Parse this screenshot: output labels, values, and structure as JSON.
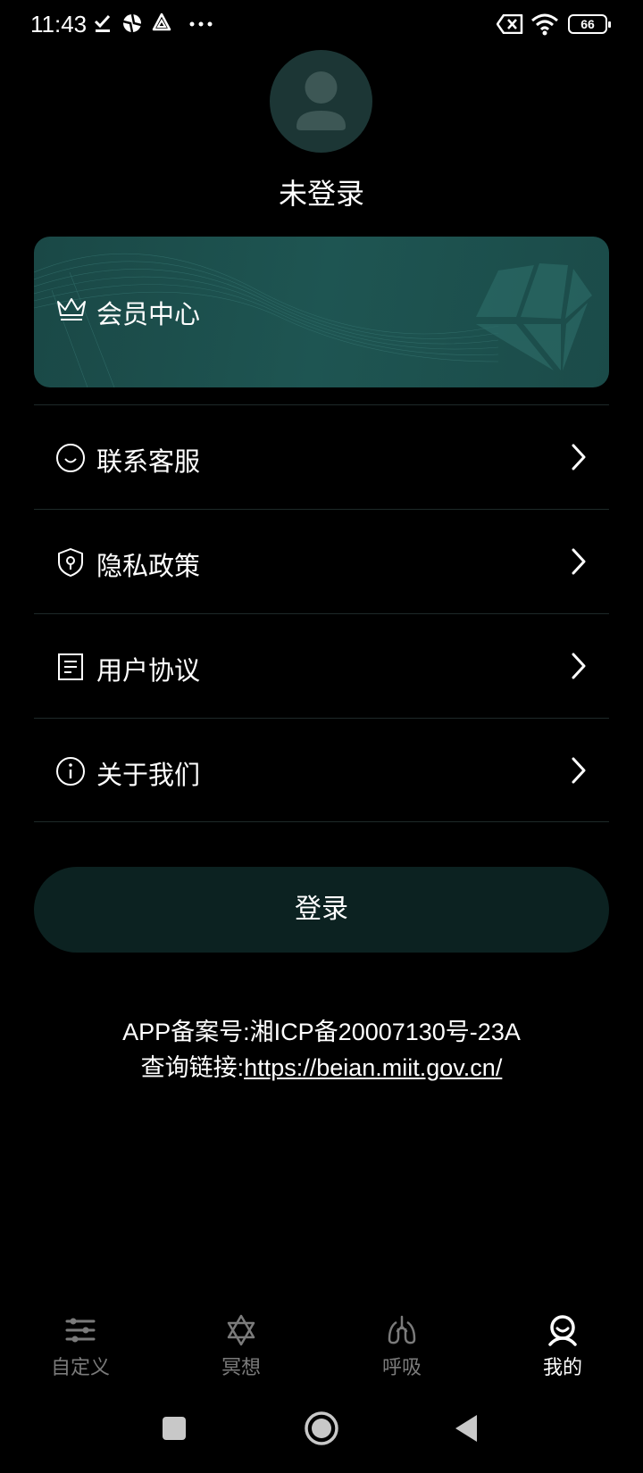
{
  "status_bar": {
    "time": "11:43",
    "battery": "66",
    "icons": [
      "check-icon",
      "app-icon",
      "triangle-icon",
      "more-dots-icon",
      "sim-off-icon",
      "wifi-icon",
      "battery-icon"
    ]
  },
  "profile": {
    "status": "未登录",
    "avatar_icon": "user-icon"
  },
  "member_card": {
    "label": "会员中心",
    "icon": "crown-icon"
  },
  "menu": {
    "items": [
      {
        "label": "联系客服",
        "icon": "smile-icon"
      },
      {
        "label": "隐私政策",
        "icon": "shield-icon"
      },
      {
        "label": "用户协议",
        "icon": "document-icon"
      },
      {
        "label": "关于我们",
        "icon": "info-icon"
      }
    ]
  },
  "login_button": {
    "label": "登录"
  },
  "footer": {
    "icp_line": "APP备案号:湘ICP备20007130号-23A",
    "query_prefix": "查询链接:",
    "query_link": "https://beian.miit.gov.cn/"
  },
  "bottom_nav": {
    "items": [
      {
        "label": "自定义",
        "icon": "sliders-icon",
        "active": false
      },
      {
        "label": "冥想",
        "icon": "star-icon",
        "active": false
      },
      {
        "label": "呼吸",
        "icon": "lungs-icon",
        "active": false
      },
      {
        "label": "我的",
        "icon": "profile-icon",
        "active": true
      }
    ]
  },
  "colors": {
    "background": "#000000",
    "card": "#1e5552",
    "button": "#0c2221",
    "inactive": "#7b7b7b"
  }
}
